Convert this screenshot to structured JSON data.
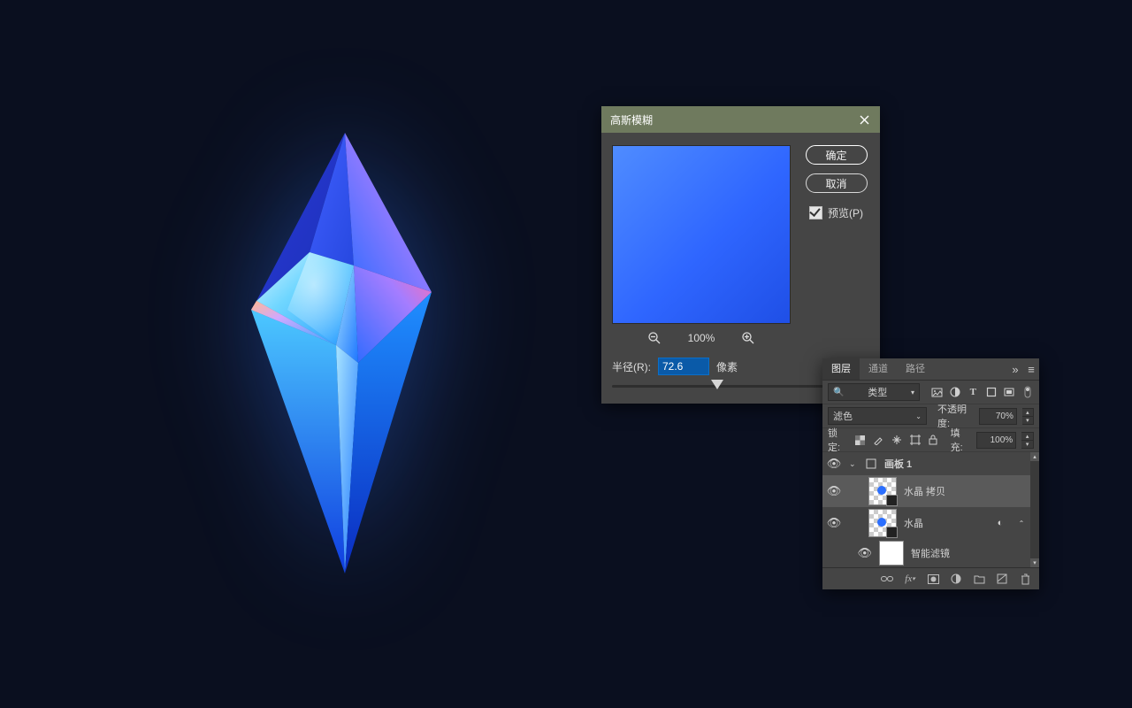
{
  "dialog": {
    "title": "高斯模糊",
    "ok": "确定",
    "cancel": "取消",
    "preview_label": "预览(P)",
    "preview_checked": true,
    "zoom": "100%",
    "radius_label": "半径(R):",
    "radius_value": "72.6",
    "radius_unit": "像素"
  },
  "panel": {
    "tabs": [
      "图层",
      "通道",
      "路径"
    ],
    "active_tab": 0,
    "filter_label": "类型",
    "blend_mode": "滤色",
    "opacity_label": "不透明度:",
    "opacity_value": "70%",
    "lock_label": "锁定:",
    "fill_label": "填充:",
    "fill_value": "100%",
    "artboard": "画板 1",
    "layers": [
      {
        "name": "水晶 拷贝",
        "visible": true,
        "selected": true,
        "smart": true
      },
      {
        "name": "水晶",
        "visible": true,
        "selected": false,
        "smart": true,
        "linked": true
      },
      {
        "name": "智能滤镜",
        "visible": true,
        "selected": false,
        "mask": true,
        "indent": true
      }
    ],
    "type_icons": [
      "image",
      "adjust",
      "text",
      "shape",
      "smart"
    ]
  }
}
